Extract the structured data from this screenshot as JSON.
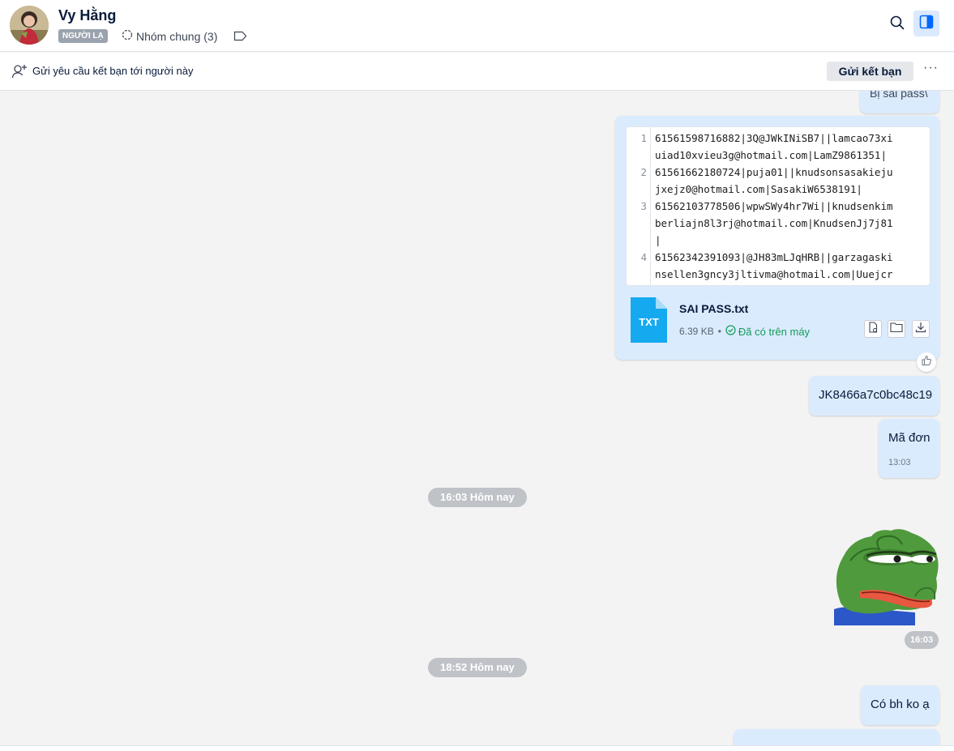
{
  "header": {
    "name": "Vy Hằng",
    "badge": "NGƯỜI LẠ",
    "groups_label": "Nhóm chung (3)"
  },
  "friend_bar": {
    "prompt": "Gửi yêu cầu kết bạn tới người này",
    "button_label": "Gửi kết bạn",
    "more_label": "···"
  },
  "messages": {
    "partial_top": "Bị sai pass\\",
    "code_lines": [
      "61561598716882|3Q@JWkINiSB7||lamcao73xi",
      "uiad10xvieu3g@hotmail.com|LamZ9861351|",
      "61561662180724|puja01||knudsonsasakieju",
      "jxejz0@hotmail.com|SasakiW6538191|",
      "61562103778506|wpwSWy4hr7Wi||knudsenkim",
      "berliajn8l3rj@hotmail.com|KnudsenJj7j81",
      "|",
      "61562342391093|@JH83mLJqHRB||garzagaski",
      "nsellen3gncy3jltivma@hotmail.com|Uuejcr"
    ],
    "line_numbers": [
      "1",
      "2",
      "3",
      "4"
    ],
    "file": {
      "type_label": "TXT",
      "name": "SAI PASS.txt",
      "size": "6.39 KB",
      "separator": "•",
      "status": "Đã có trên máy"
    },
    "code_msg": "JK8466a7c0bc48c19",
    "ma_don": "Mã đơn",
    "ma_don_time": "13:03",
    "divider_1": "16:03 Hôm nay",
    "sticker_time": "16:03",
    "divider_2": "18:52 Hôm nay",
    "last_msg": "Có bh ko ạ"
  },
  "colors": {
    "bubble": "#dbebfe",
    "background": "#f3f3f3",
    "accent": "#0068ff",
    "file_icon": "#15aaf0",
    "status_green": "#129b5a"
  }
}
